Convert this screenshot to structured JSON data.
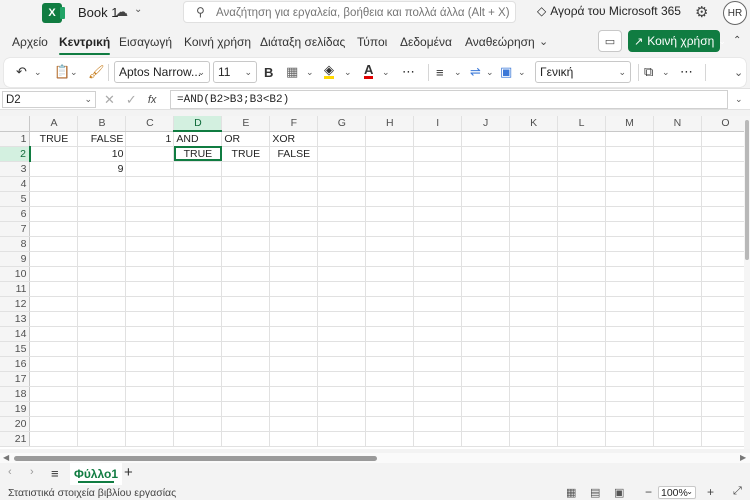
{
  "titlebar": {
    "app_logo": "X",
    "book_title": "Book 1",
    "search_placeholder": "Αναζήτηση για εργαλεία, βοήθεια και πολλά άλλα (Alt + X)",
    "ms365_label": "Αγορά του Microsoft 365",
    "avatar_initials": "HR"
  },
  "ribbon": {
    "tabs": [
      "Αρχείο",
      "Κεντρική",
      "Εισαγωγή",
      "Κοινή χρήση",
      "Διάταξη σελίδας",
      "Τύποι",
      "Δεδομένα",
      "Αναθεώρηση"
    ],
    "active_tab": "Κεντρική",
    "share_label": "Κοινή χρήση"
  },
  "toolbar": {
    "font_name": "Aptos Narrow...",
    "font_size": "11",
    "bold_label": "B",
    "number_format": "Γενική"
  },
  "formula_bar": {
    "cell_ref": "D2",
    "fx_label": "fx",
    "formula": "=AND(B2>B3;B3<B2)"
  },
  "sheet": {
    "columns": [
      "A",
      "B",
      "C",
      "D",
      "E",
      "F",
      "G",
      "H",
      "I",
      "J",
      "K",
      "L",
      "M",
      "N",
      "O"
    ],
    "selected_column": "D",
    "selected_row": "2",
    "row_numbers": [
      "1",
      "2",
      "3",
      "4",
      "5",
      "6",
      "7",
      "8",
      "9",
      "10",
      "11",
      "12",
      "13",
      "14",
      "15",
      "16",
      "17",
      "18",
      "19",
      "20",
      "21"
    ],
    "cells": {
      "A1": "TRUE",
      "B1": "FALSE",
      "C1": "1",
      "D1": "AND",
      "E1": "OR",
      "F1": "XOR",
      "B2": "10",
      "D2": "TRUE",
      "E2": "TRUE",
      "F2": "FALSE",
      "B3": "9"
    }
  },
  "sheet_tabs": {
    "active_sheet": "Φύλλο1",
    "add_label": "+"
  },
  "status_bar": {
    "stats_text": "Στατιστικά στοιχεία βιβλίου εργασίας",
    "zoom": "100%"
  },
  "colors": {
    "accent": "#107c41",
    "selected_header_bg": "#d3f0e0"
  }
}
